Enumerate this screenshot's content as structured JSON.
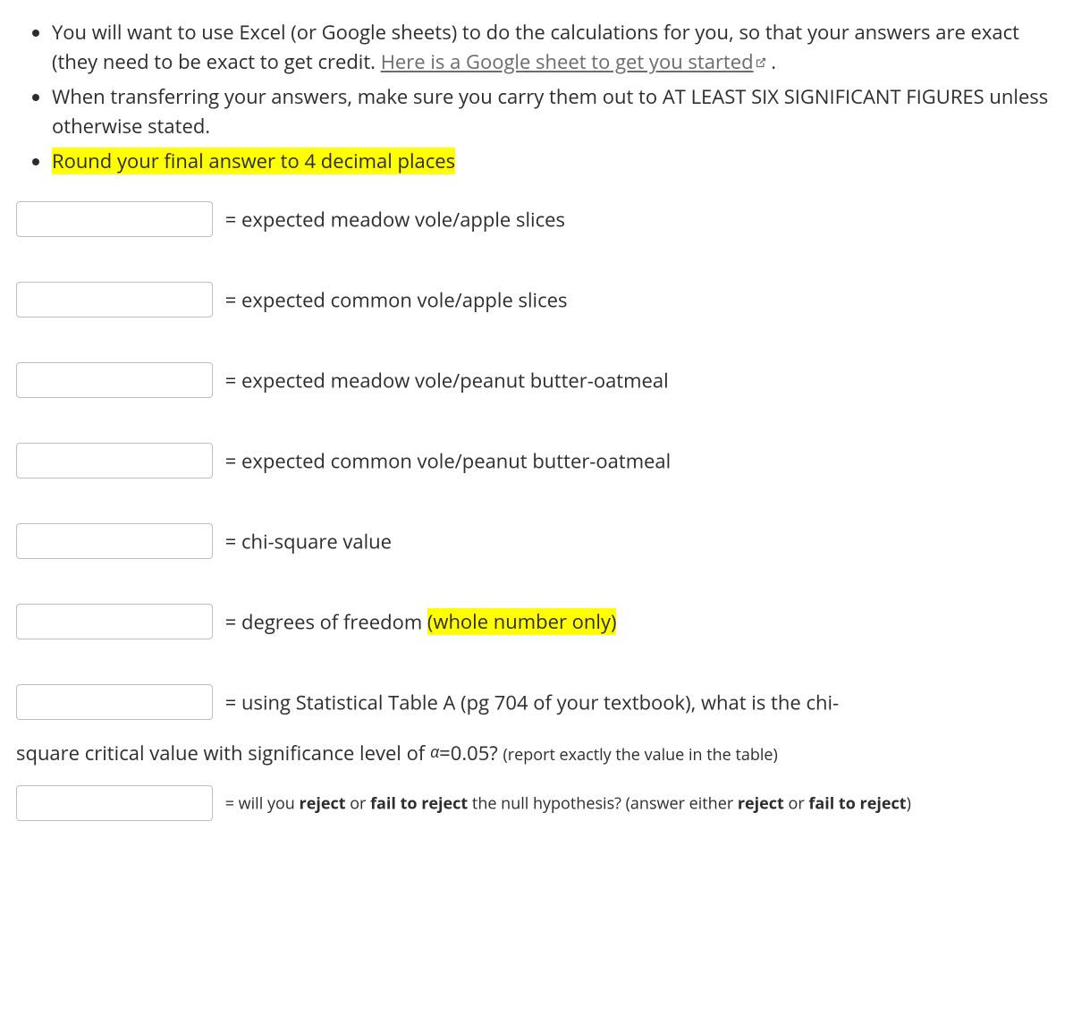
{
  "instructions": {
    "bullet1_part1": "You will want to use Excel (or Google sheets) to do the calculations for you, so that your answers are exact (they need to be exact to get credit. ",
    "bullet1_link": "Here is a Google sheet to get you started",
    "bullet1_part2": " .",
    "bullet2": "When transferring your answers, make sure you carry them out to AT LEAST SIX SIGNIFICANT FIGURES unless otherwise stated.",
    "bullet3_highlight": "Round your final answer to 4 decimal places"
  },
  "questions": {
    "q1": {
      "value": "",
      "label": "= expected meadow vole/apple slices"
    },
    "q2": {
      "value": "",
      "label": "= expected common vole/apple slices"
    },
    "q3": {
      "value": "",
      "label": "= expected meadow vole/peanut butter-oatmeal"
    },
    "q4": {
      "value": "",
      "label": "= expected common vole/peanut butter-oatmeal"
    },
    "q5": {
      "value": "",
      "label": "= chi-square value"
    },
    "q6": {
      "value": "",
      "label_before": "= degrees of freedom ",
      "label_highlight": "(whole number only)"
    },
    "q7": {
      "value": "",
      "label_line1": "= using Statistical Table A (pg 704 of your textbook), what is the chi-",
      "label_line2_a": "square critical value with significance level of ",
      "alpha": "α",
      "label_line2_b": "=0.05? ",
      "label_line2_note": "(report exactly the value in the table)"
    },
    "q8": {
      "value": "",
      "label_a": "= will you ",
      "reject": "reject",
      "label_b": " or ",
      "fail": "fail to reject",
      "label_c": " the null hypothesis? (answer either ",
      "label_d": " or ",
      "label_e": ")"
    }
  }
}
